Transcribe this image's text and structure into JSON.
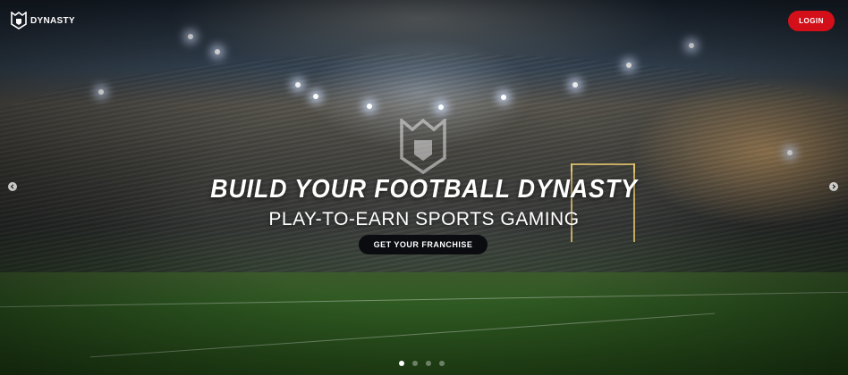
{
  "header": {
    "logo_text": "DYNASTY",
    "logo_icon": "g-shield-logo-icon",
    "login_label": "LOGIN"
  },
  "hero": {
    "headline": "BUILD YOUR FOOTBALL DYNASTY",
    "subheadline": "PLAY-TO-EARN SPORTS GAMING",
    "cta_label": "GET YOUR FRANCHISE",
    "center_icon": "g-shield-logo-icon",
    "prev_icon": "chevron-left-icon",
    "next_icon": "chevron-right-icon"
  },
  "carousel": {
    "slide_count": 4,
    "active_index": 0
  },
  "colors": {
    "accent": "#d3101a",
    "cta_background": "#0a0c10",
    "text": "#ffffff"
  }
}
